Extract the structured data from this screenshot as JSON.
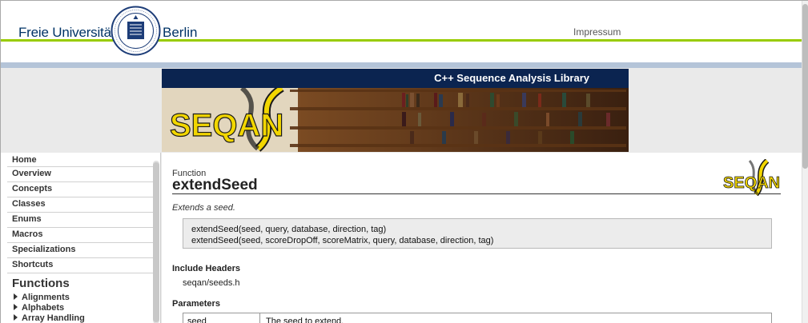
{
  "header": {
    "university_left": "Freie Universität",
    "university_right": "Berlin",
    "impressum": "Impressum"
  },
  "banner": {
    "title": "C++ Sequence Analysis Library",
    "logo_text": "SEQAN"
  },
  "sidebar": {
    "items": [
      {
        "label": "Home"
      },
      {
        "label": "Overview"
      },
      {
        "label": "Concepts"
      },
      {
        "label": "Classes"
      },
      {
        "label": "Enums"
      },
      {
        "label": "Macros"
      },
      {
        "label": "Specializations"
      },
      {
        "label": "Shortcuts"
      }
    ],
    "heading": "Functions",
    "subitems": [
      {
        "label": "Alignments"
      },
      {
        "label": "Alphabets"
      },
      {
        "label": "Array Handling"
      }
    ]
  },
  "main": {
    "kind": "Function",
    "name": "extendSeed",
    "description": "Extends a seed.",
    "signatures": [
      "extendSeed(seed, query, database, direction, tag)",
      "extendSeed(seed, scoreDropOff, scoreMatrix, query, database, direction, tag)"
    ],
    "include_heading": "Include Headers",
    "include_file": "seqan/seeds.h",
    "params_heading": "Parameters",
    "params": [
      {
        "name": "seed",
        "desc": "The seed to extend."
      }
    ]
  },
  "colors": {
    "accent_green": "#99cc00",
    "banner_navy": "#0b2450",
    "fu_blue": "#003366",
    "seqan_yellow": "#f2d600"
  }
}
